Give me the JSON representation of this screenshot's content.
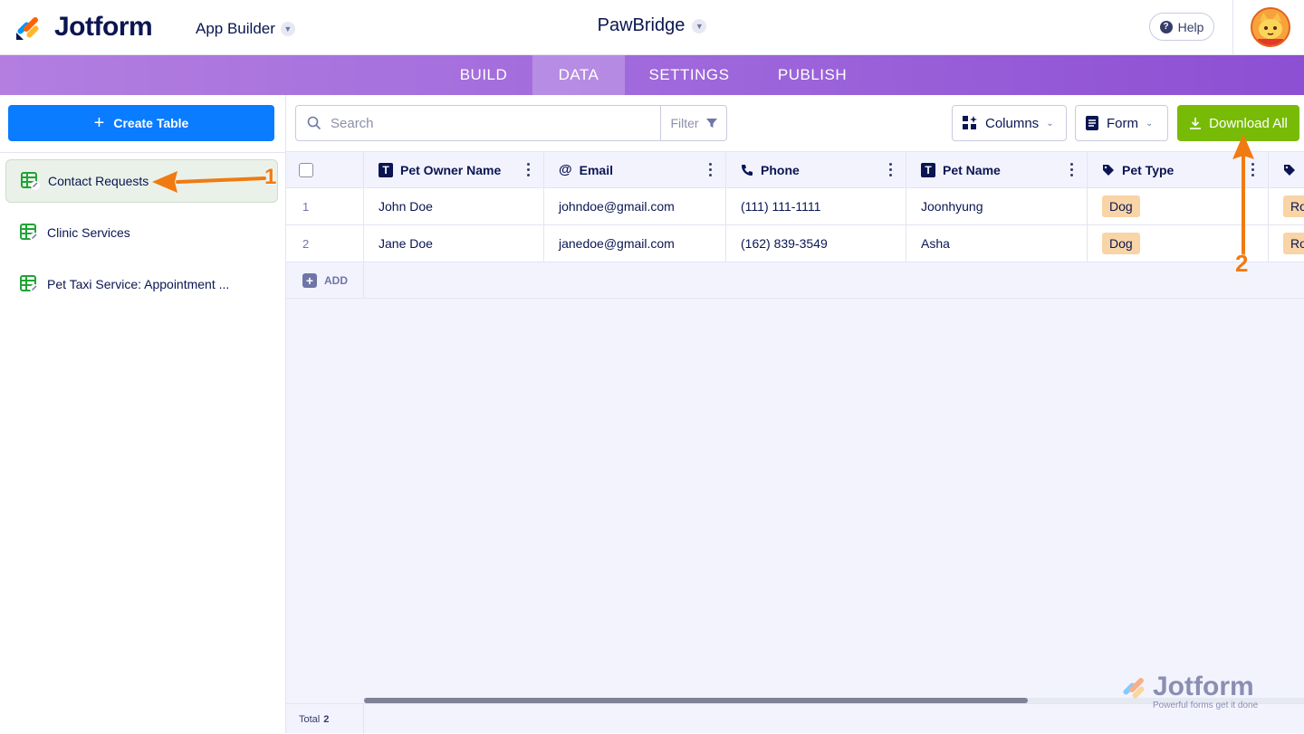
{
  "header": {
    "brand": "Jotform",
    "product": "App Builder",
    "app_name": "PawBridge",
    "help_label": "Help"
  },
  "nav": {
    "tabs": [
      {
        "label": "BUILD"
      },
      {
        "label": "DATA"
      },
      {
        "label": "SETTINGS"
      },
      {
        "label": "PUBLISH"
      }
    ],
    "active": "DATA"
  },
  "sidebar": {
    "create_label": "Create Table",
    "items": [
      {
        "label": "Contact Requests"
      },
      {
        "label": "Clinic Services"
      },
      {
        "label": "Pet Taxi Service: Appointment ..."
      }
    ]
  },
  "toolbar": {
    "search_placeholder": "Search",
    "filter_label": "Filter",
    "columns_label": "Columns",
    "form_label": "Form",
    "download_label": "Download All"
  },
  "table": {
    "columns": [
      {
        "label": "Pet Owner Name",
        "icon": "text-icon"
      },
      {
        "label": "Email",
        "icon": "at-icon"
      },
      {
        "label": "Phone",
        "icon": "phone-icon"
      },
      {
        "label": "Pet Name",
        "icon": "text-icon"
      },
      {
        "label": "Pet Type",
        "icon": "tag-icon"
      },
      {
        "label": "",
        "icon": "tag-icon"
      }
    ],
    "rows": [
      {
        "num": "1",
        "owner": "John Doe",
        "email": "johndoe@gmail.com",
        "phone": "(111) 111-1111",
        "pet": "Joonhyung",
        "type": "Dog",
        "extra": "Ro"
      },
      {
        "num": "2",
        "owner": "Jane Doe",
        "email": "janedoe@gmail.com",
        "phone": "(162) 839-3549",
        "pet": "Asha",
        "type": "Dog",
        "extra": "Ro"
      }
    ],
    "add_label": "ADD",
    "total_label": "Total",
    "total_count": "2"
  },
  "annotations": {
    "marker_1": "1",
    "marker_2": "2"
  },
  "watermark": {
    "word": "Jotform",
    "tagline": "Powerful forms get it done"
  },
  "colors": {
    "accent_blue": "#0a7cff",
    "download_green": "#78bb07",
    "nav_purple": "#a069dc",
    "annotation_orange": "#f07b12",
    "tag_bg": "#f9d4a7"
  }
}
